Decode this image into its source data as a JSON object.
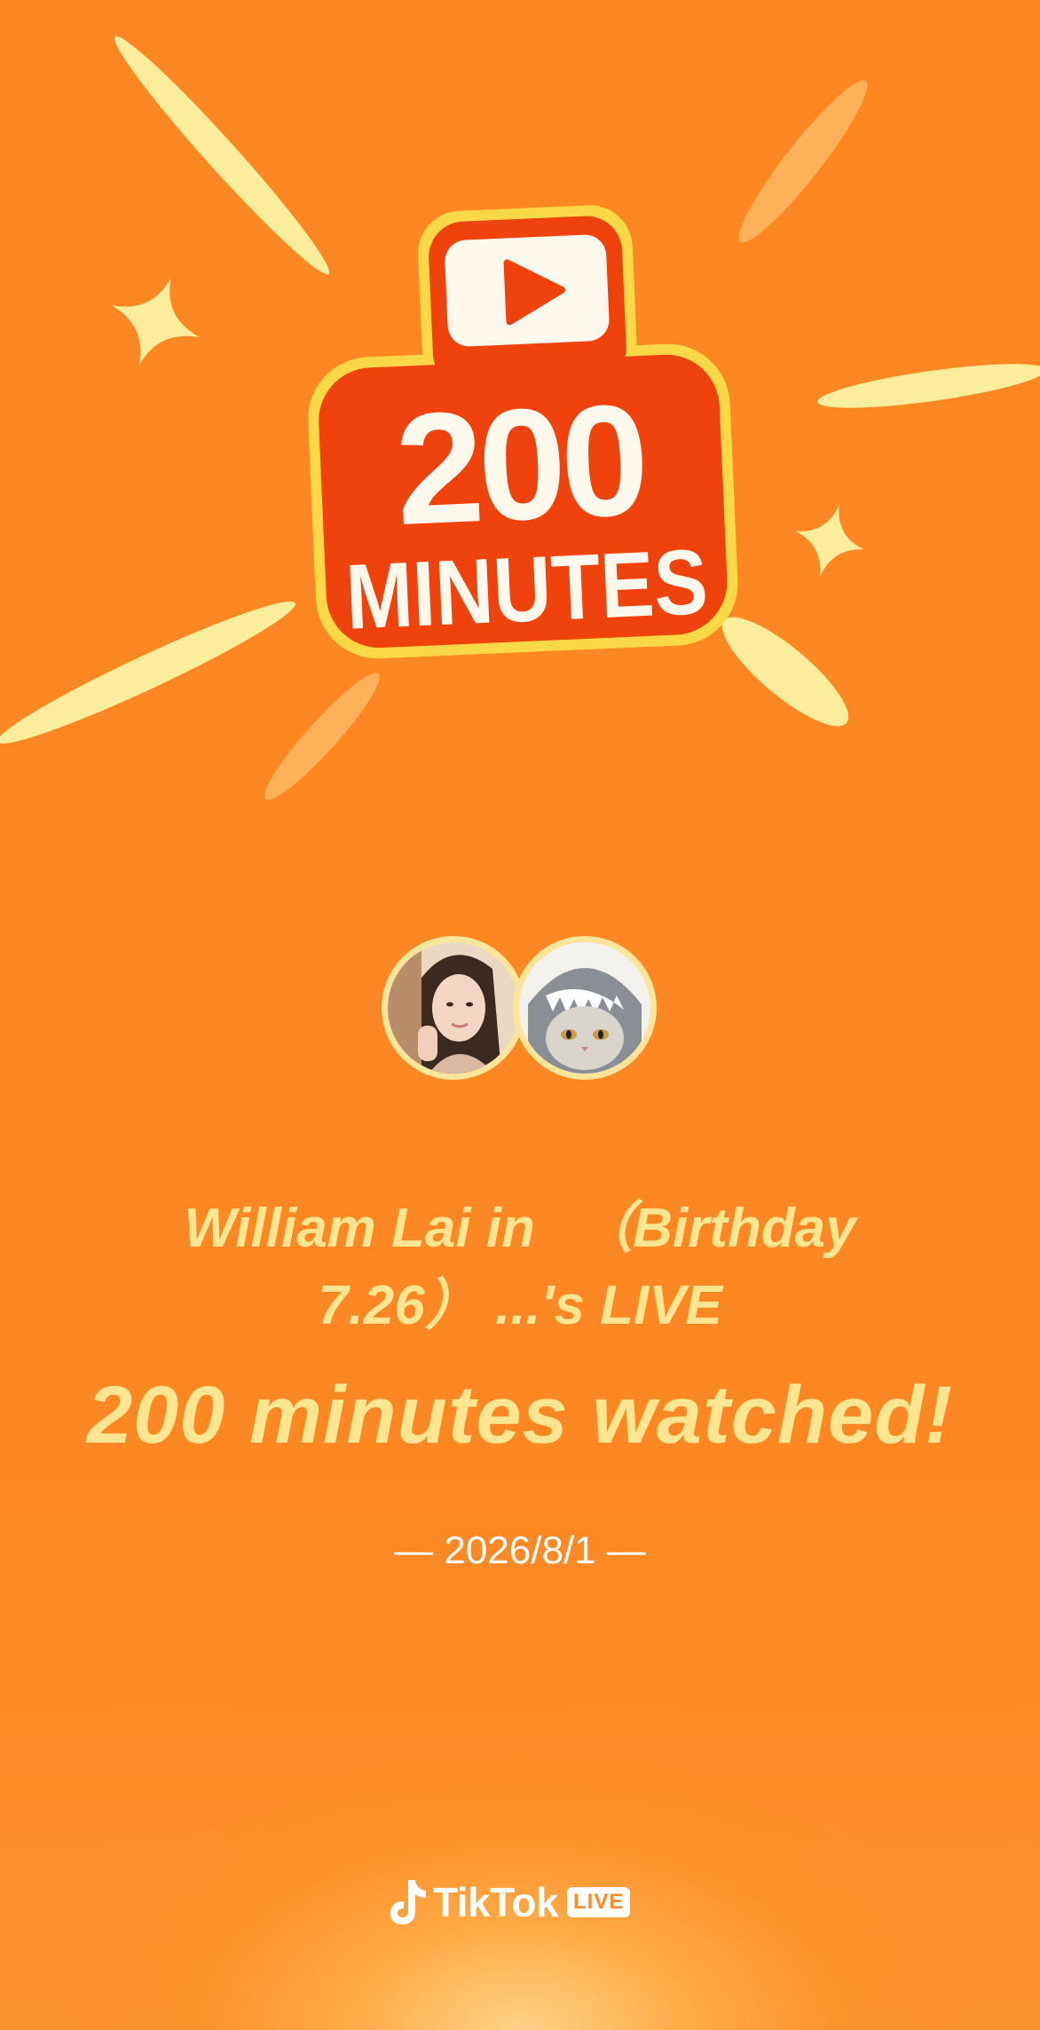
{
  "badge": {
    "number": "200",
    "unit_label": "MINUTES",
    "icon": "play-icon"
  },
  "avatars": [
    {
      "icon": "user-photo-avatar"
    },
    {
      "icon": "cat-in-shark-hat-avatar"
    }
  ],
  "stream": {
    "line1": "William Lai in 　（Birthday",
    "line2": "7.26） ...'s LIVE"
  },
  "headline": "200 minutes watched!",
  "date": {
    "dash_left": "—",
    "value": "2026/8/1",
    "dash_right": "—"
  },
  "brand": {
    "name": "TikTok",
    "badge": "LIVE",
    "icon": "tiktok-note-icon"
  },
  "colors": {
    "background": "#fd8722",
    "text_yellow": "#fde592",
    "badge_red": "#f0420c",
    "ray_yellow": "#fbed9c"
  }
}
